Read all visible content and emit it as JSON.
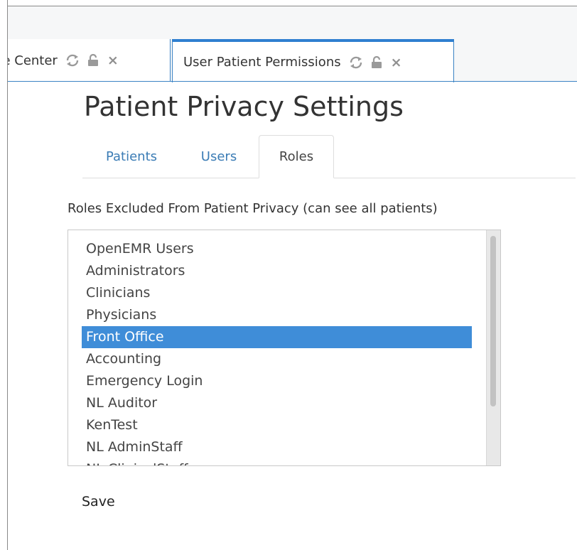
{
  "tabs": [
    {
      "label": "Message Center",
      "visible_label": "age Center"
    },
    {
      "label": "User Patient Permissions"
    }
  ],
  "tab_icons": [
    "refresh-icon",
    "unlock-icon",
    "close-icon"
  ],
  "tab_close_glyph": "×",
  "page": {
    "title": "Patient Privacy Settings"
  },
  "nav": [
    {
      "label": "Patients"
    },
    {
      "label": "Users"
    },
    {
      "label": "Roles",
      "active": true
    }
  ],
  "roles_section": {
    "label": "Roles Excluded From Patient Privacy (can see all patients)",
    "options": [
      {
        "label": "OpenEMR Users"
      },
      {
        "label": "Administrators"
      },
      {
        "label": "Clinicians"
      },
      {
        "label": "Physicians"
      },
      {
        "label": "Front Office",
        "selected": true
      },
      {
        "label": "Accounting"
      },
      {
        "label": "Emergency Login"
      },
      {
        "label": "NL Auditor"
      },
      {
        "label": "KenTest"
      },
      {
        "label": "NL AdminStaff"
      },
      {
        "label": "NL ClinicalStaff"
      }
    ]
  },
  "actions": {
    "save_label": "Save"
  },
  "colors": {
    "accent": "#2f7fd0",
    "link": "#3b7cb5",
    "selected_bg": "#3f8dd8"
  }
}
